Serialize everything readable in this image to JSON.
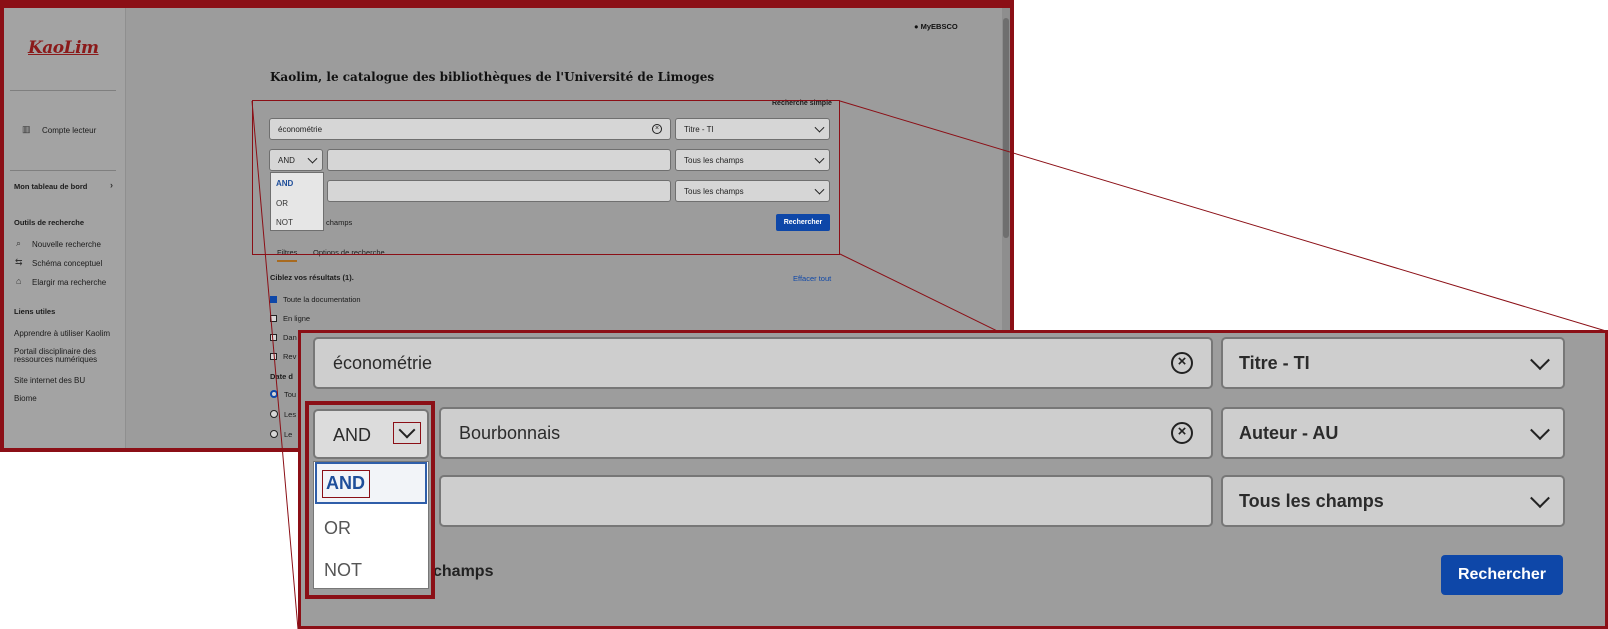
{
  "app": {
    "logo_text": "KaoLim",
    "myebsco_label": "MyEBSCO",
    "page_title": "Kaolim, le catalogue des bibliothèques de l'Université de Limoges"
  },
  "sidebar": {
    "account_label": "Compte lecteur",
    "dashboard_label": "Mon tableau de bord",
    "tools_heading": "Outils de recherche",
    "tools": [
      {
        "label": "Nouvelle recherche",
        "icon": "search-icon"
      },
      {
        "label": "Schéma conceptuel",
        "icon": "concept-map-icon"
      },
      {
        "label": "Elargir ma recherche",
        "icon": "library-icon"
      }
    ],
    "links_heading": "Liens utiles",
    "links": [
      "Apprendre à utiliser Kaolim",
      "Portail disciplinaire des ressources numériques",
      "Site internet des BU",
      "Biome"
    ]
  },
  "search": {
    "mode_toggle": "Recherche simple",
    "rows": [
      {
        "value": "économétrie",
        "field": "Titre - TI"
      },
      {
        "operator": "AND",
        "value": "Bourbonnais",
        "field": "Auteur - AU"
      },
      {
        "value": "",
        "field": "Tous les champs"
      }
    ],
    "overview_rows": [
      {
        "value": "économétrie",
        "field": "Titre - TI"
      },
      {
        "operator": "AND",
        "value": "",
        "field": "Tous les champs"
      },
      {
        "value": "",
        "field": "Tous les champs"
      }
    ],
    "operator_options": [
      "AND",
      "OR",
      "NOT"
    ],
    "add_fields_partial": "champs",
    "search_button": "Rechercher"
  },
  "filters": {
    "tabs": [
      "Filtres",
      "Options de recherche"
    ],
    "results_heading": "Ciblez vos résultats (1).",
    "clear_all": "Effacer tout",
    "checkboxes": [
      {
        "label": "Toute la documentation",
        "checked": true
      },
      {
        "label": "En ligne",
        "checked": false
      },
      {
        "label": "Dan",
        "checked": false
      },
      {
        "label": "Rev",
        "checked": false
      }
    ],
    "date_heading_partial": "Date d",
    "radios": [
      {
        "label": "Tou",
        "checked": true
      },
      {
        "label": "Les",
        "checked": false
      },
      {
        "label": "Le",
        "checked": false
      }
    ]
  },
  "colors": {
    "accent_blue": "#0e47a8",
    "highlight_red": "#8b0f16",
    "logo_red": "#8b1a1a"
  }
}
